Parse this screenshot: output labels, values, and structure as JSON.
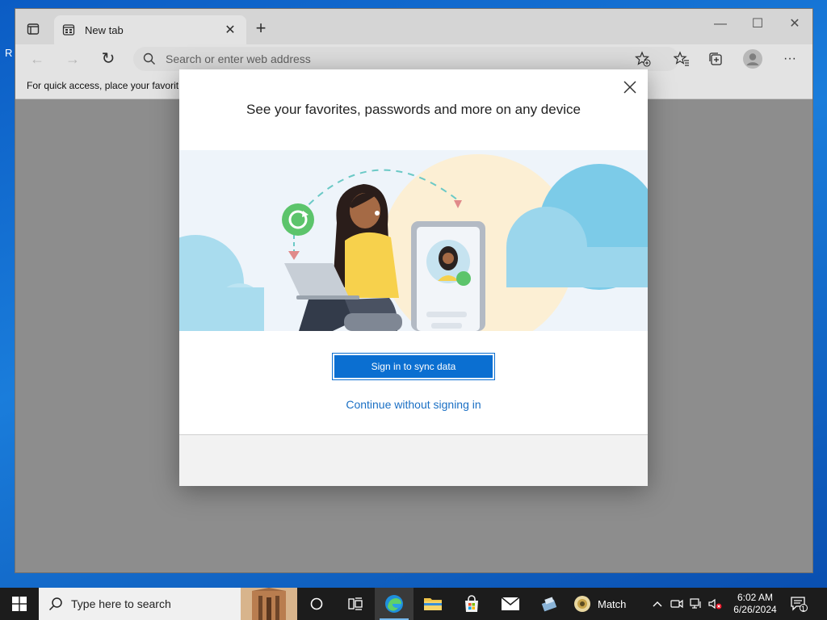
{
  "browser": {
    "tab": {
      "title": "New tab",
      "close_glyph": "✕"
    },
    "new_tab_glyph": "+",
    "window_controls": {
      "minimize": "—",
      "maximize": "☐",
      "close": "✕"
    },
    "nav": {
      "back": "←",
      "forward": "→",
      "refresh": "↻"
    },
    "address": {
      "placeholder": "Search or enter web address"
    },
    "more_menu": "···",
    "favorites_bar_text": "For quick access, place your favorit"
  },
  "dialog": {
    "title": "See your favorites, passwords and more on any device",
    "primary_button": "Sign in to sync data",
    "secondary_link": "Continue without signing in",
    "close_glyph": "✕"
  },
  "desktop": {
    "fragment_letter": "R"
  },
  "taskbar": {
    "search_placeholder": "Type here to search",
    "weather_label": "Match",
    "clock": {
      "time": "6:02 AM",
      "date": "6/26/2024"
    },
    "notification_count": "1"
  },
  "colors": {
    "accent": "#0b6fd1",
    "link": "#1a6fc4",
    "taskbar": "#1c1c1c"
  }
}
